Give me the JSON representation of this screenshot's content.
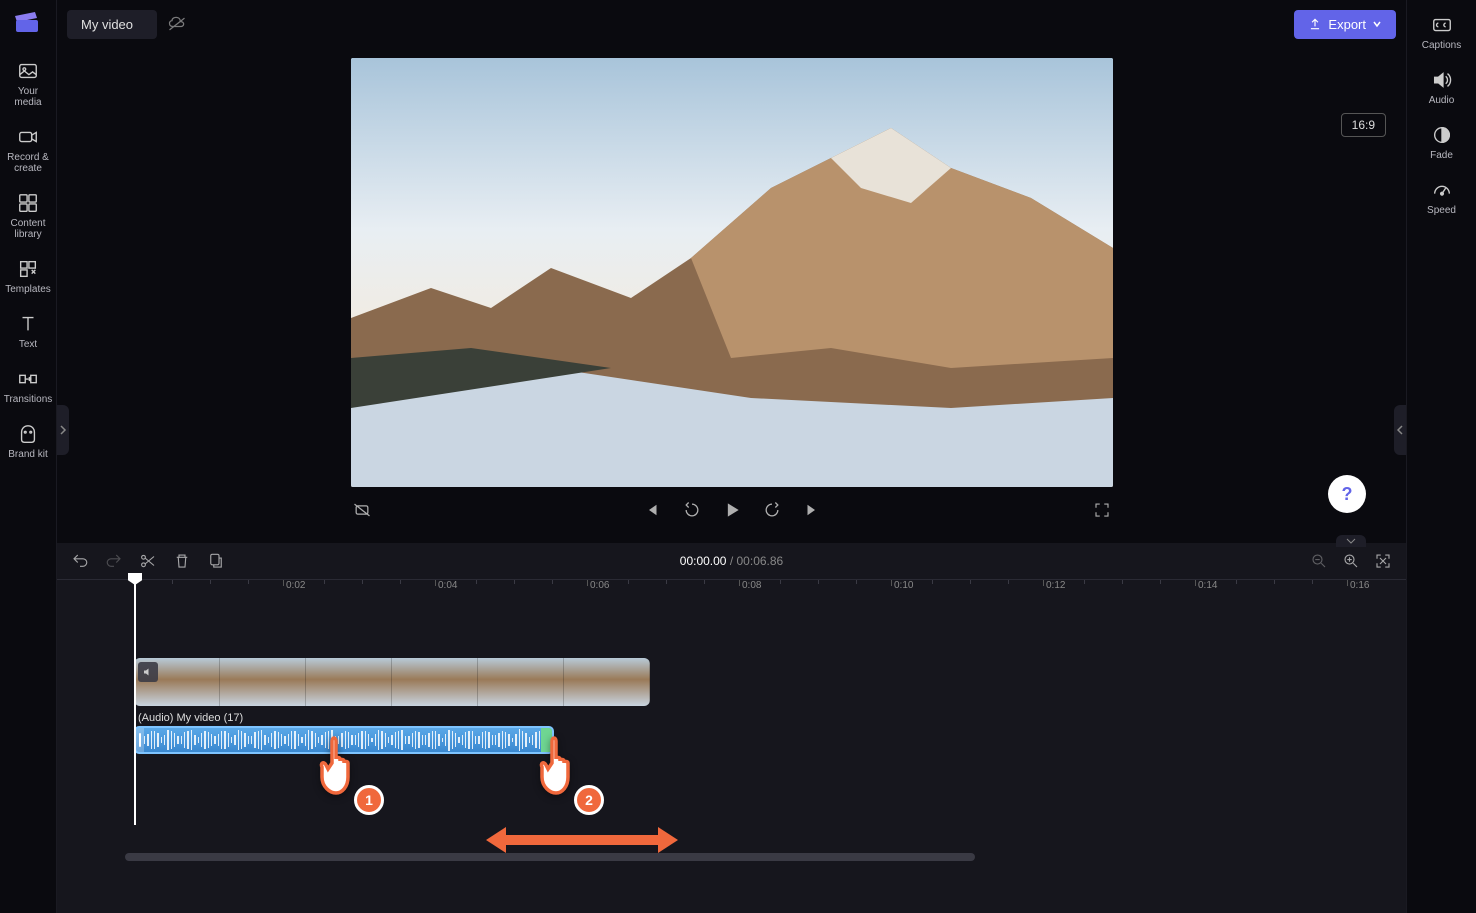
{
  "header": {
    "title": "My video",
    "export_label": "Export"
  },
  "left_nav": {
    "items": [
      {
        "icon": "media-icon",
        "label": "Your media"
      },
      {
        "icon": "record-icon",
        "label": "Record & create"
      },
      {
        "icon": "library-icon",
        "label": "Content library"
      },
      {
        "icon": "templates-icon",
        "label": "Templates"
      },
      {
        "icon": "text-icon",
        "label": "Text"
      },
      {
        "icon": "transitions-icon",
        "label": "Transitions"
      },
      {
        "icon": "brandkit-icon",
        "label": "Brand kit"
      }
    ]
  },
  "right_nav": {
    "items": [
      {
        "icon": "captions-icon",
        "label": "Captions"
      },
      {
        "icon": "audio-icon",
        "label": "Audio"
      },
      {
        "icon": "fade-icon",
        "label": "Fade"
      },
      {
        "icon": "speed-icon",
        "label": "Speed"
      }
    ]
  },
  "preview": {
    "aspect_ratio": "16:9"
  },
  "timeline": {
    "current_time": "00:00.00",
    "duration": "00:06.86",
    "ticks": [
      "0:02",
      "0:04",
      "0:06",
      "0:08",
      "0:10",
      "0:12",
      "0:14",
      "0:16"
    ],
    "audio_clip_label": "(Audio) My video (17)"
  },
  "annotations": {
    "hand1": "1",
    "hand2": "2"
  }
}
